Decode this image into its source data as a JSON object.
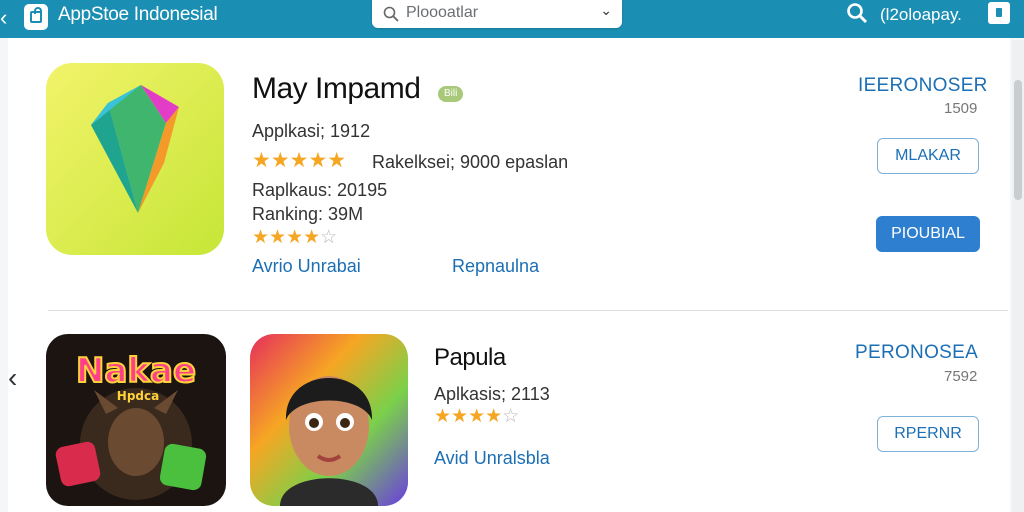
{
  "header": {
    "back_icon": "chevron-left-icon",
    "brand_title": "AppStoe Indonesial",
    "search_text": "Ploooatlar",
    "user_text": "(l2oloapay.",
    "icons": [
      "store-bag-icon",
      "search-icon",
      "chevron-down-icon",
      "cart-icon"
    ]
  },
  "apps": [
    {
      "title": "May Impamd",
      "tag": "Bili",
      "aplikasi": "Applkasi; 1912",
      "rating_stars": 5,
      "rating_text": "Rakelksei; 9000 epaslan",
      "raplkaus": "Raplkaus: 20195",
      "ranking": "Ranking: 39M",
      "sub_stars": 4.5,
      "link1": "Avrio Unrabai",
      "link2": "Repnaulna",
      "publisher": "IEERONOSER",
      "pub_count": "1509",
      "button_outline": "MLAKAR",
      "button_primary": "PIOUBIAL"
    },
    {
      "title": "Papula",
      "aplikasi": "Aplkasis; 2113",
      "sub_stars": 4.5,
      "link1": "Avid Unralsbla",
      "publisher": "PERONOSEA",
      "pub_count": "7592",
      "button_outline": "RPERNR",
      "game_title": "Nakae",
      "game_sub": "Hpdca"
    }
  ],
  "colors": {
    "topbar": "#1a8fb3",
    "accent": "#1c6fb5",
    "primary_button": "#2f7fd0",
    "star": "#f5a623"
  }
}
